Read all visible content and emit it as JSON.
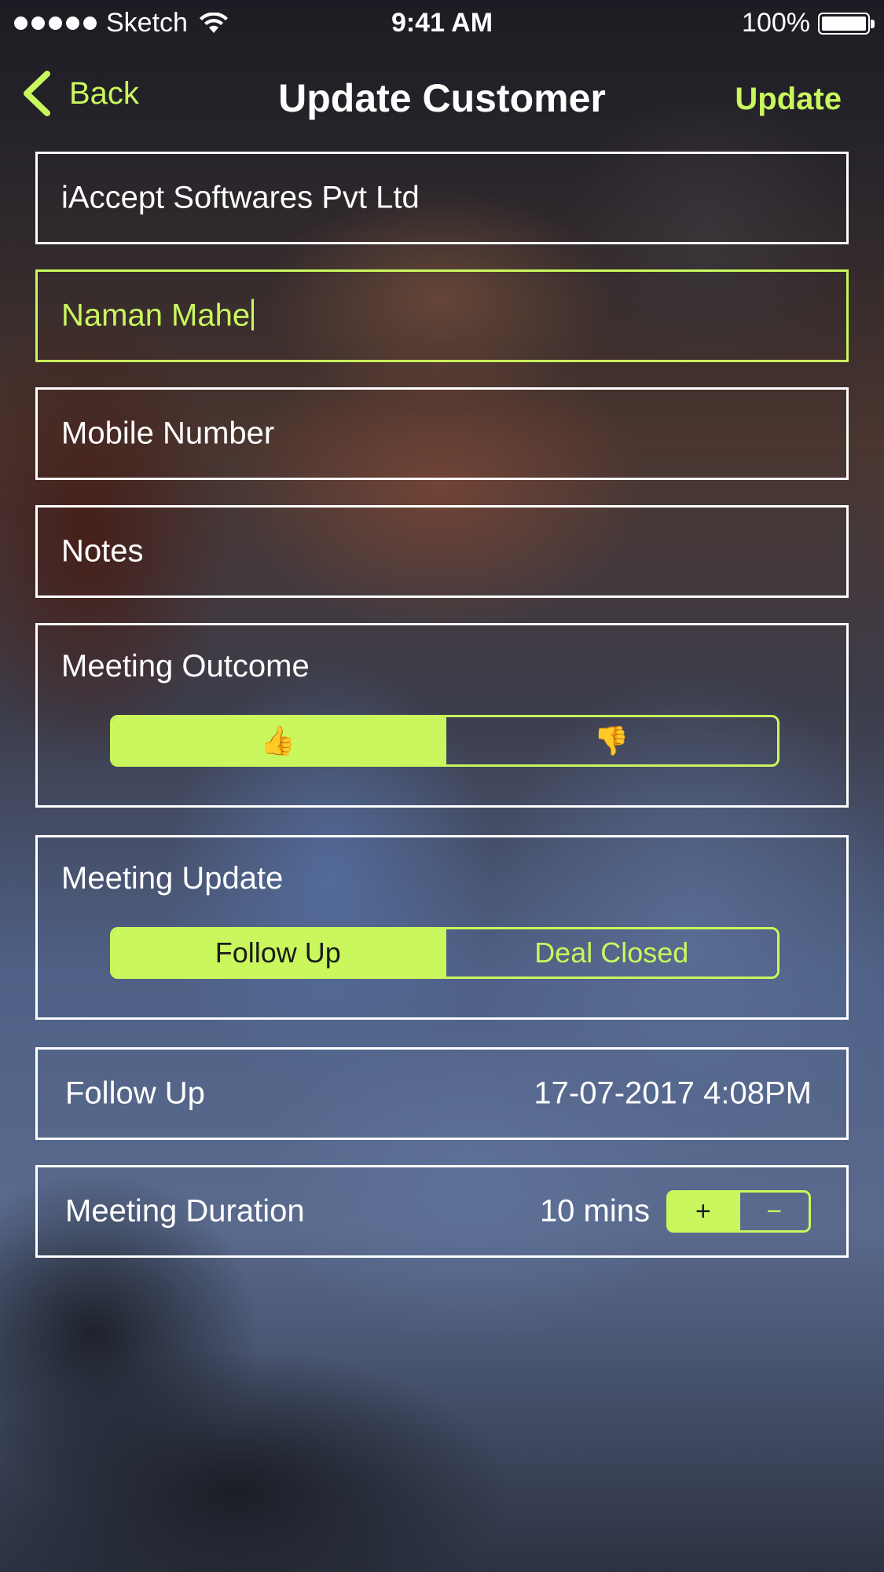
{
  "status_bar": {
    "carrier": "Sketch",
    "time": "9:41 AM",
    "battery": "100%"
  },
  "nav": {
    "back_label": "Back",
    "title": "Update Customer",
    "update_label": "Update"
  },
  "form": {
    "company": "iAccept Softwares Pvt Ltd",
    "contact_name": "Naman Mahe",
    "mobile_placeholder": "Mobile Number",
    "notes_placeholder": "Notes",
    "meeting_outcome": {
      "label": "Meeting Outcome",
      "options": [
        "👍",
        "👎"
      ],
      "selected": "👍"
    },
    "meeting_update": {
      "label": "Meeting Update",
      "options": [
        "Follow Up",
        "Deal Closed"
      ],
      "selected": "Follow Up"
    },
    "follow_up": {
      "label": "Follow Up",
      "value": "17-07-2017 4:08PM"
    },
    "meeting_duration": {
      "label": "Meeting Duration",
      "value": "10 mins",
      "increment": "+",
      "decrement": "−"
    }
  },
  "colors": {
    "accent": "#c9f75d",
    "border": "#ffffff",
    "text": "#ffffff"
  }
}
